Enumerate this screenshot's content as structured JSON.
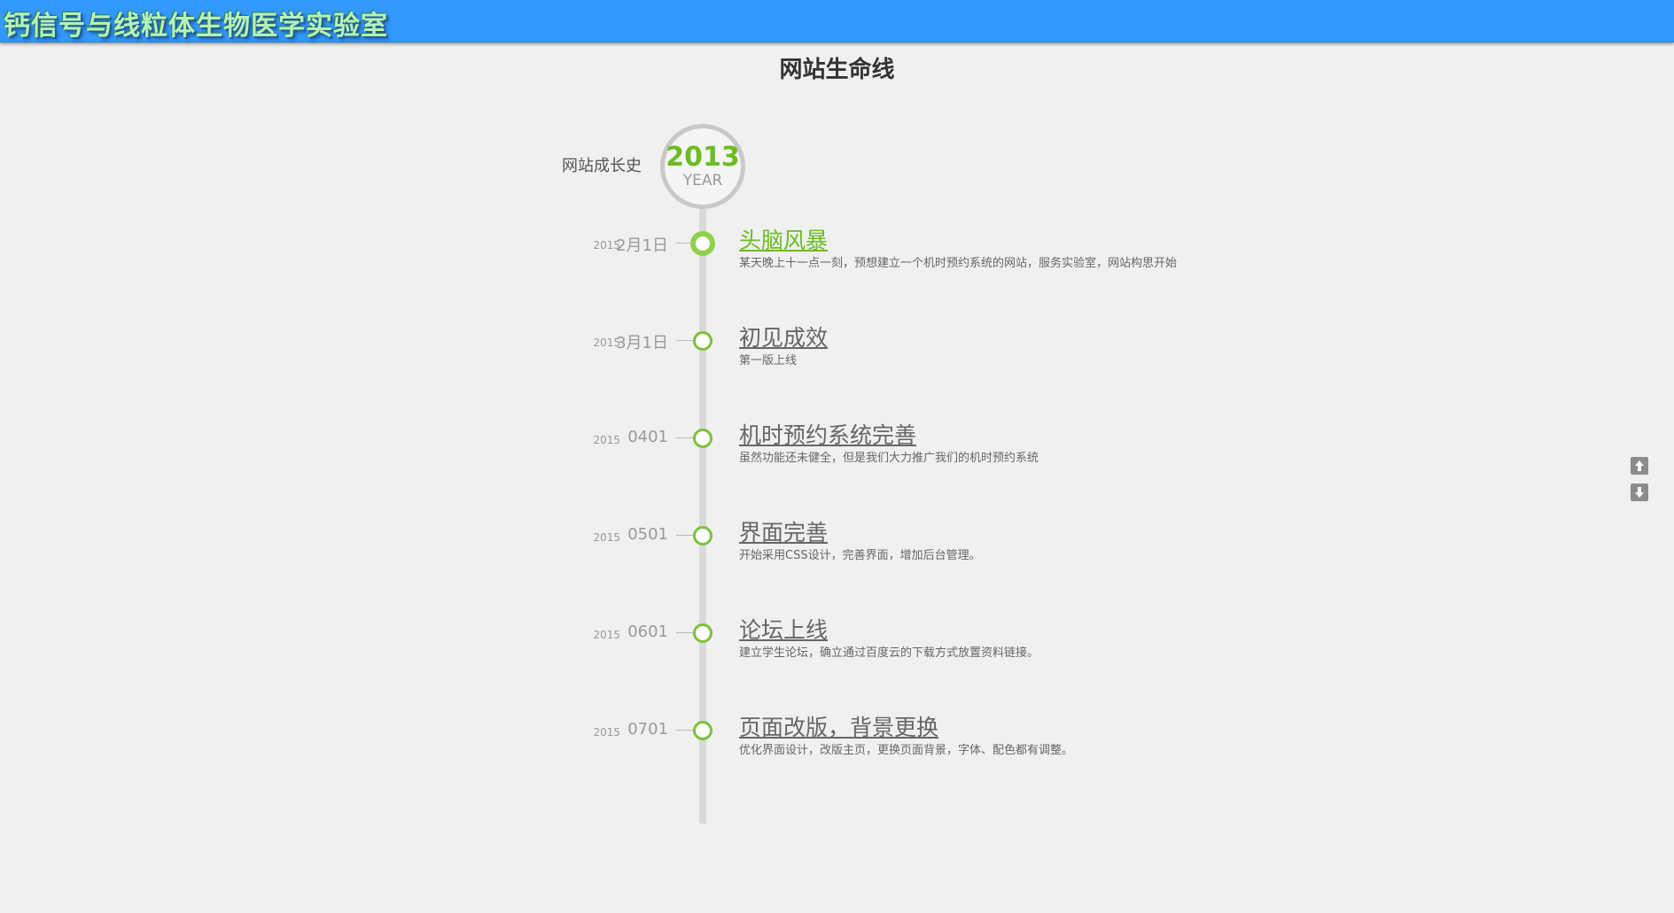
{
  "header": {
    "site_title": "钙信号与线粒体生物医学实验室"
  },
  "page": {
    "title": "网站生命线"
  },
  "timeline": {
    "history_label": "网站成长史",
    "year": "2013",
    "year_sub": "YEAR",
    "events": [
      {
        "year": "2015",
        "date": "2月1日",
        "title": "头脑风暴",
        "desc": "某天晚上十一点一刻，预想建立一个机时预约系统的网站，服务实验室，网站构思开始",
        "active": true
      },
      {
        "year": "2015",
        "date": "3月1日",
        "title": "初见成效",
        "desc": "第一版上线",
        "active": false
      },
      {
        "year": "2015",
        "date": "0401",
        "title": "机时预约系统完善",
        "desc": "虽然功能还未健全，但是我们大力推广我们的机时预约系统",
        "active": false
      },
      {
        "year": "2015",
        "date": "0501",
        "title": "界面完善",
        "desc": "开始采用CSS设计，完善界面，增加后台管理。",
        "active": false
      },
      {
        "year": "2015",
        "date": "0601",
        "title": "论坛上线",
        "desc": "建立学生论坛，确立通过百度云的下载方式放置资料链接。",
        "active": false
      },
      {
        "year": "2015",
        "date": "0701",
        "title": "页面改版，背景更换",
        "desc": "优化界面设计，改版主页，更换页面背景，字体、配色都有调整。",
        "active": false
      }
    ]
  },
  "scroll": {
    "up_icon": "arrow-up-icon",
    "down_icon": "arrow-down-icon"
  },
  "colors": {
    "header_bg": "#3399ff",
    "accent_green": "#6cbc22",
    "page_bg": "#eff0ef"
  }
}
